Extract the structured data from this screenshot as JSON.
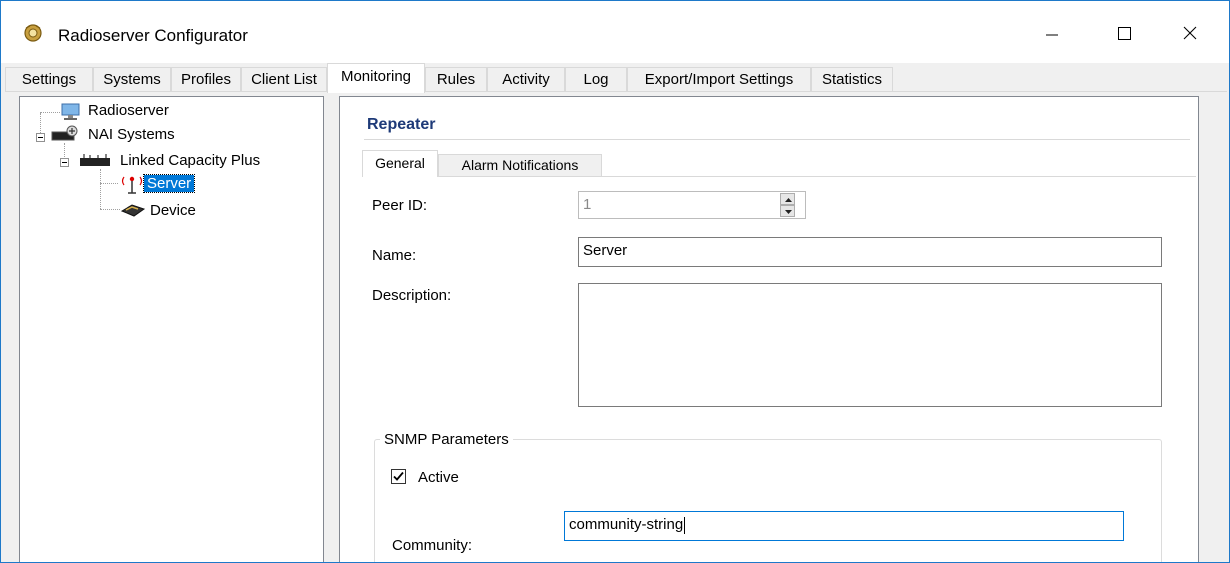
{
  "window": {
    "title": "Radioserver Configurator",
    "app_icon": "radioserver-app-icon",
    "controls": {
      "minimize": "minimize-icon",
      "maximize": "maximize-icon",
      "close": "close-icon"
    }
  },
  "tabs": [
    {
      "label": "Settings",
      "active": false
    },
    {
      "label": "Systems",
      "active": false
    },
    {
      "label": "Profiles",
      "active": false
    },
    {
      "label": "Client List",
      "active": false
    },
    {
      "label": "Monitoring",
      "active": true
    },
    {
      "label": "Rules",
      "active": false
    },
    {
      "label": "Activity",
      "active": false
    },
    {
      "label": "Log",
      "active": false
    },
    {
      "label": "Export/Import Settings",
      "active": false
    },
    {
      "label": "Statistics",
      "active": false
    }
  ],
  "tree": {
    "nodes": [
      {
        "label": "Radioserver",
        "icon": "computer-icon"
      },
      {
        "label": "NAI Systems",
        "icon": "system-icon"
      },
      {
        "label": "Linked Capacity Plus",
        "icon": "network-icon"
      },
      {
        "label": "Server",
        "icon": "antenna-icon",
        "selected": true
      },
      {
        "label": "Device",
        "icon": "device-icon"
      }
    ]
  },
  "content": {
    "title": "Repeater",
    "subtabs": [
      {
        "label": "General",
        "active": true
      },
      {
        "label": "Alarm Notifications",
        "active": false
      }
    ],
    "peer_id": {
      "label": "Peer ID:",
      "value": "1"
    },
    "name": {
      "label": "Name:",
      "value": "Server"
    },
    "description": {
      "label": "Description:",
      "value": ""
    },
    "snmp": {
      "group_label": "SNMP Parameters",
      "active_label": "Active",
      "active_checked": true,
      "community_label": "Community:",
      "community_value": "community-string"
    }
  },
  "colors": {
    "accent": "#0078d7",
    "section_title": "#1e3a78",
    "window_border": "#1e79c9"
  }
}
